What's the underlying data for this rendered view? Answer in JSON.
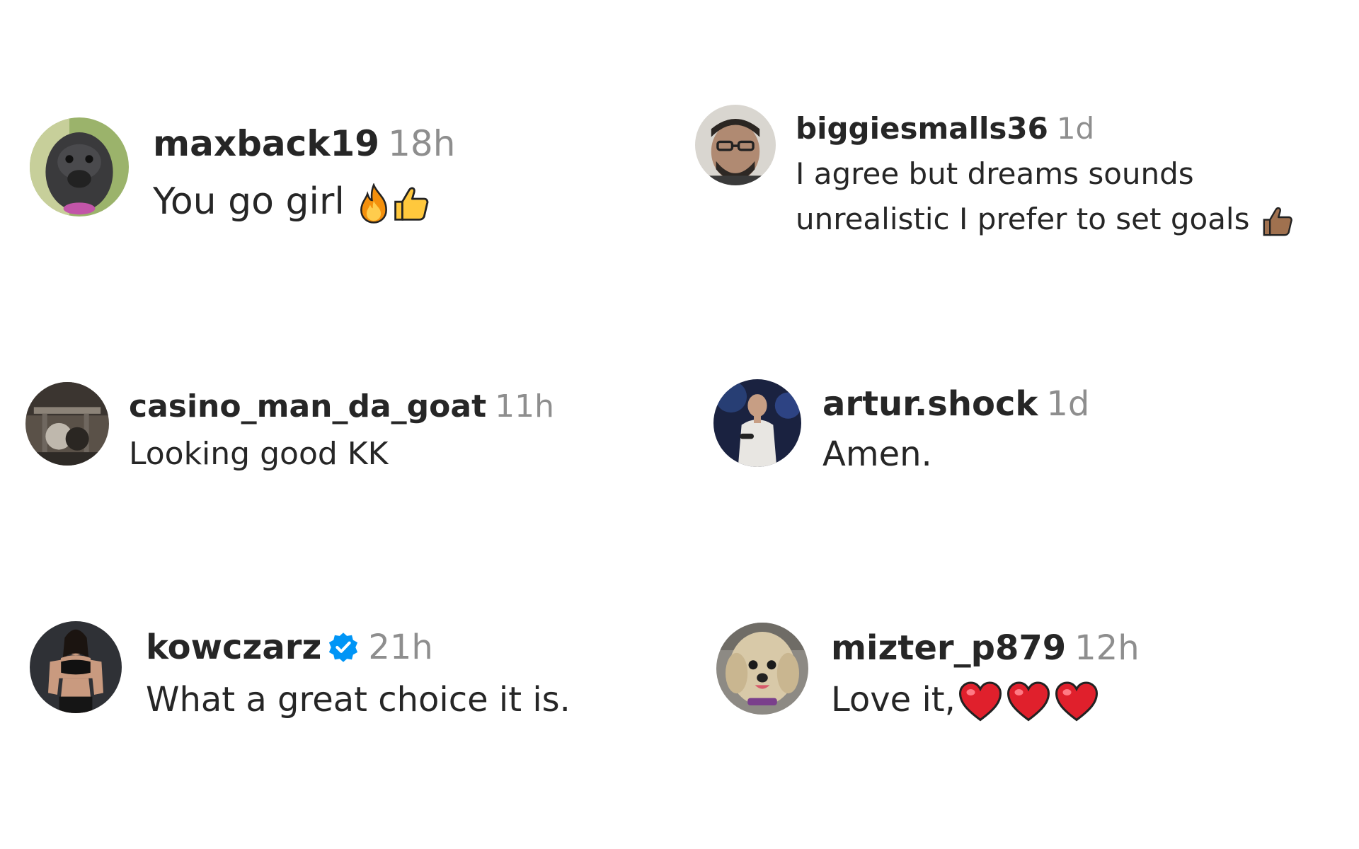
{
  "comments": [
    {
      "username": "maxback19",
      "time": "18h",
      "text": "You go girl",
      "emojis": [
        "fire",
        "thumbs-up"
      ],
      "avatar": "dog-avatar"
    },
    {
      "username": "biggiesmalls36",
      "time": "1d",
      "text": "I agree but dreams sounds unrealistic I prefer to set goals",
      "emojis": [
        "thumbs-up-medium-dark"
      ],
      "avatar": "man-glasses-avatar"
    },
    {
      "username": "casino_man_da_goat",
      "time": "11h",
      "text": "Looking good KK",
      "emojis": [],
      "avatar": "gym-avatar"
    },
    {
      "username": "artur.shock",
      "time": "1d",
      "text": "Amen.",
      "emojis": [],
      "avatar": "man-stage-avatar"
    },
    {
      "username": "kowczarz",
      "time": "21h",
      "text": "What a great choice it is.",
      "emojis": [],
      "verified": true,
      "avatar": "woman-fitness-avatar"
    },
    {
      "username": "mizter_p879",
      "time": "12h",
      "text": "Love it,",
      "emojis": [
        "red-heart",
        "red-heart",
        "red-heart"
      ],
      "avatar": "fluffy-dog-avatar"
    }
  ],
  "colors": {
    "text": "#262626",
    "muted": "#8e8e8e",
    "verified": "#0095f6",
    "heart": "#e0202c",
    "fire": "#f4900c",
    "thumb_yellow": "#ffc83d",
    "thumb_brown": "#a0714f"
  }
}
